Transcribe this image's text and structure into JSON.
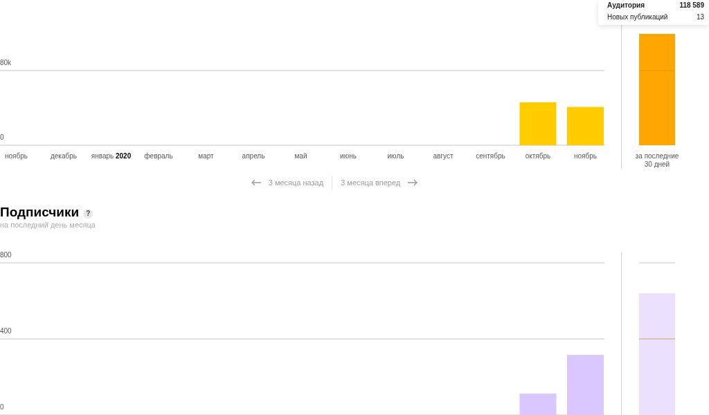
{
  "tooltip": {
    "rows": [
      {
        "label": "Аудитория",
        "value": "118 589",
        "emphasized": true
      },
      {
        "label": "Новых публикаций",
        "value": "13",
        "emphasized": false
      }
    ]
  },
  "audience": {
    "chart_data": {
      "type": "bar",
      "categories": [
        "ноябрь",
        "декабрь",
        "январь **2020**",
        "февраль",
        "март",
        "апрель",
        "май",
        "июнь",
        "июль",
        "август",
        "сентябрь",
        "октябрь",
        "ноябрь"
      ],
      "values": [
        null,
        null,
        null,
        null,
        null,
        null,
        null,
        null,
        null,
        null,
        null,
        46000,
        41000
      ],
      "ylim": [
        0,
        80000
      ],
      "yticks": [
        {
          "value": 0,
          "label": "0"
        },
        {
          "value": 80000,
          "label": "80k"
        }
      ]
    },
    "summary": {
      "label": "за последние 30 дней"
    }
  },
  "pager": {
    "back": "3 месяца назад",
    "forward": "3 месяца вперед"
  },
  "subscribers": {
    "title": "Подписчики",
    "help": "?",
    "subtitle": "на последний день месяца",
    "chart_data": {
      "type": "bar",
      "values": [
        null,
        null,
        null,
        null,
        null,
        null,
        null,
        null,
        null,
        null,
        null,
        113,
        316
      ],
      "ylim": [
        0,
        800
      ],
      "yticks": [
        {
          "value": 0,
          "label": "0"
        },
        {
          "value": 400,
          "label": "400"
        },
        {
          "value": 800,
          "label": "800"
        }
      ]
    }
  }
}
